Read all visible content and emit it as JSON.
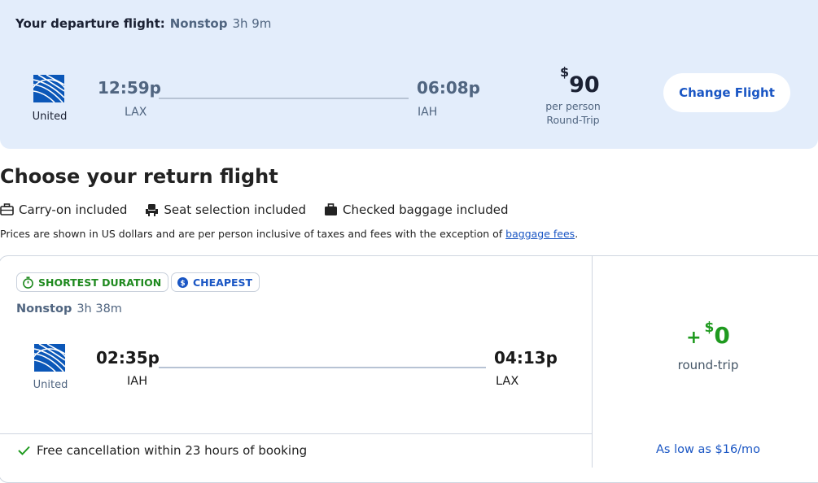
{
  "departure": {
    "title": "Your departure flight:",
    "stops": "Nonstop",
    "duration": "3h 9m",
    "airline": "United",
    "depart_time": "12:59p",
    "depart_code": "LAX",
    "arrive_time": "06:08p",
    "arrive_code": "IAH",
    "price_symbol": "$",
    "price": "90",
    "price_note_1": "per person",
    "price_note_2": "Round-Trip",
    "change_button": "Change Flight"
  },
  "return_section": {
    "heading": "Choose your return flight",
    "amenities": [
      {
        "icon": "carry-on-icon",
        "label": "Carry-on included"
      },
      {
        "icon": "seat-icon",
        "label": "Seat selection included"
      },
      {
        "icon": "checked-bag-icon",
        "label": "Checked baggage included"
      }
    ],
    "disclaimer": "Prices are shown in US dollars and are per person inclusive of taxes and fees with the exception of",
    "disclaimer_link": "baggage fees",
    "disclaimer_end": "."
  },
  "return_flight": {
    "badges": [
      {
        "icon": "stopwatch-icon",
        "label": "SHORTEST DURATION",
        "color": "#1f8a1f"
      },
      {
        "icon": "dollar-coin-icon",
        "label": "CHEAPEST",
        "color": "#1a56c4"
      }
    ],
    "stops": "Nonstop",
    "duration": "3h 38m",
    "airline": "United",
    "depart_time": "02:35p",
    "depart_code": "IAH",
    "arrive_time": "04:13p",
    "arrive_code": "LAX",
    "plus": "+",
    "price_symbol": "$",
    "price": "0",
    "price_note": "round-trip",
    "free_cancel": "Free cancellation within 23 hours of booking",
    "as_low_as": "As low as $16/mo"
  },
  "colors": {
    "banner_bg": "#e3edfb",
    "accent_blue": "#1a56c4",
    "green": "#1f9a1f"
  }
}
